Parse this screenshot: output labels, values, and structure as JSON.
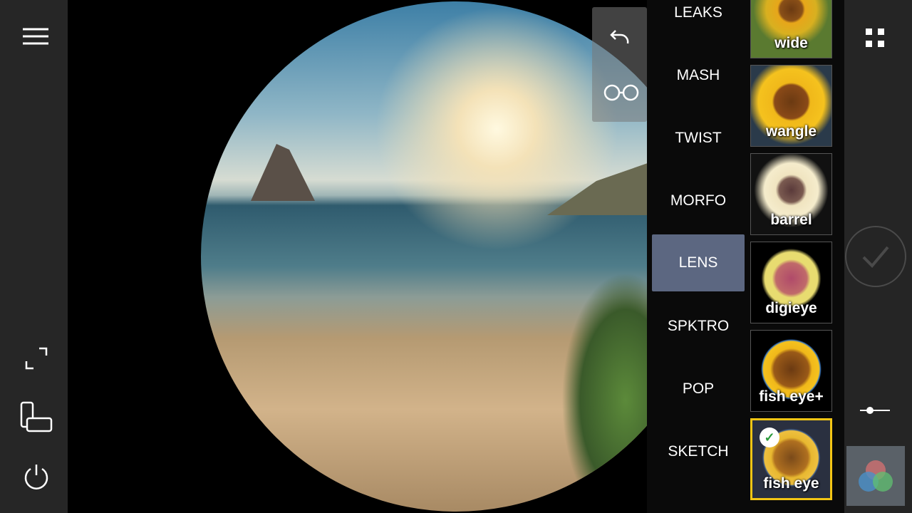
{
  "left_toolbar": {
    "icons": [
      "menu-icon",
      "fullscreen-icon",
      "switch-camera-icon",
      "power-icon"
    ]
  },
  "overlay": {
    "icons": [
      "undo-icon",
      "glasses-icon"
    ]
  },
  "categories": [
    {
      "label": "LEAKS",
      "active": false
    },
    {
      "label": "MASH",
      "active": false
    },
    {
      "label": "TWIST",
      "active": false
    },
    {
      "label": "MORFO",
      "active": false
    },
    {
      "label": "LENS",
      "active": true
    },
    {
      "label": "SPKTRO",
      "active": false
    },
    {
      "label": "POP",
      "active": false
    },
    {
      "label": "SKETCH",
      "active": false
    }
  ],
  "effects": [
    {
      "label": "wide",
      "selected": false
    },
    {
      "label": "wangle",
      "selected": false
    },
    {
      "label": "barrel",
      "selected": false
    },
    {
      "label": "digieye",
      "selected": false
    },
    {
      "label": "fish eye+",
      "selected": false
    },
    {
      "label": "fish eye",
      "selected": true
    }
  ],
  "right_toolbar": {
    "icons": [
      "grid-icon",
      "shutter-check-icon",
      "slider-icon",
      "color-filter-icon"
    ]
  },
  "colors": {
    "selected_border": "#f4c614",
    "active_category": "#78879f"
  }
}
